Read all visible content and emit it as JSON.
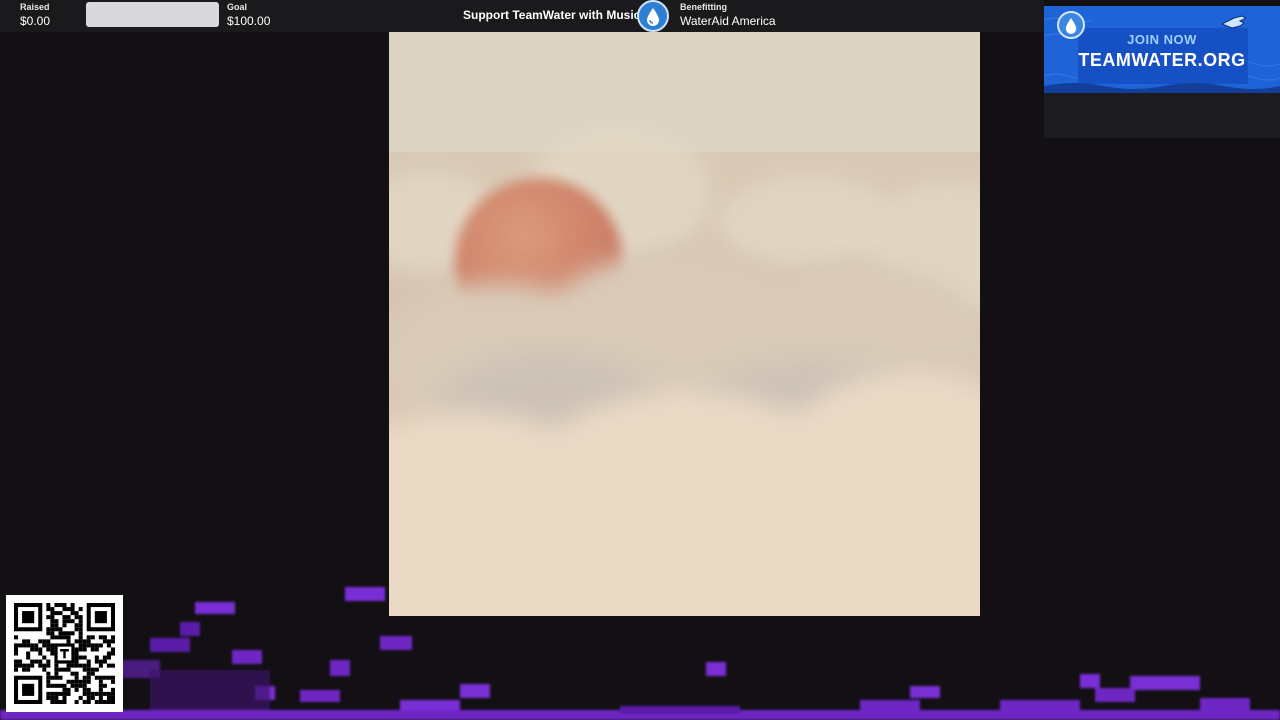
{
  "fundraiser": {
    "raised_label": "Raised",
    "raised_value": "$0.00",
    "goal_label": "Goal",
    "goal_value": "$100.00",
    "progress_fraction": 0,
    "title": "Support TeamWater with Music",
    "benefit_label": "Benefitting",
    "benefit_value": "WaterAid America"
  },
  "banner": {
    "join": "JOIN NOW",
    "site": "TEAMWATER.ORG"
  },
  "icons": {
    "water_drop": "water-drop-icon",
    "pointing_hand": "pointing-hand-icon",
    "qr": "qr-code"
  },
  "colors": {
    "accent": "#1f63d8",
    "visualizer": "#7a2fd6",
    "background": "#121013"
  }
}
